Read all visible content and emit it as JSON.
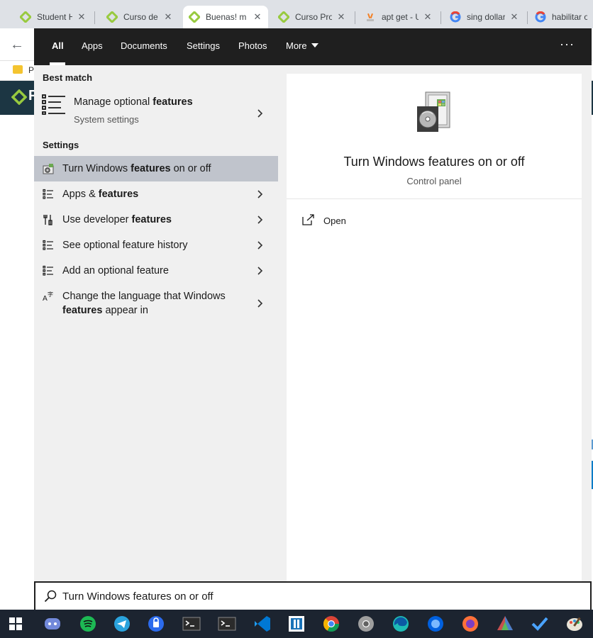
{
  "browser": {
    "tabs": [
      {
        "label": "Student He",
        "icon": "platzi-icon"
      },
      {
        "label": "Curso de P",
        "icon": "platzi-icon"
      },
      {
        "label": "Buenas! m",
        "icon": "platzi-icon"
      },
      {
        "label": "Curso Prof",
        "icon": "platzi-icon"
      },
      {
        "label": "apt get - U",
        "icon": "stackoverflow-icon"
      },
      {
        "label": "sing dollar",
        "icon": "google-icon"
      },
      {
        "label": "habilitar o",
        "icon": "google-icon"
      }
    ],
    "close_glyph": "✕",
    "bookmark_label": "P",
    "site_logo_text": "P"
  },
  "start": {
    "filters": {
      "all": "All",
      "apps": "Apps",
      "documents": "Documents",
      "settings": "Settings",
      "photos": "Photos",
      "more": "More"
    },
    "overflow": "···",
    "best_match": {
      "heading": "Best match",
      "title_prefix": "Manage optional ",
      "title_bold": "features",
      "subtitle": "System settings"
    },
    "settings": {
      "heading": "Settings",
      "items": [
        {
          "prefix": "Turn Windows ",
          "bold": "features",
          "suffix": " on or off",
          "icon": "control-panel-icon"
        },
        {
          "prefix": "Apps & ",
          "bold": "features",
          "suffix": "",
          "icon": "apps-list-icon"
        },
        {
          "prefix": "Use developer ",
          "bold": "features",
          "suffix": "",
          "icon": "developer-tools-icon"
        },
        {
          "prefix": "See optional feature history",
          "bold": "",
          "suffix": "",
          "icon": "history-list-icon"
        },
        {
          "prefix": "Add an optional feature",
          "bold": "",
          "suffix": "",
          "icon": "add-list-icon"
        },
        {
          "prefix": "Change the language that Windows",
          "bold": "features",
          "suffix": " appear in",
          "icon": "language-icon"
        }
      ]
    },
    "preview": {
      "title": "Turn Windows features on or off",
      "subtitle": "Control panel",
      "action_open": "Open"
    },
    "search": {
      "value": "Turn Windows features on or off",
      "placeholder": ""
    }
  },
  "taskbar": {
    "items": [
      "windows-start-icon",
      "discord-icon",
      "spotify-icon",
      "telegram-icon",
      "signal-icon",
      "terminal-icon",
      "terminal-icon",
      "vscode-icon",
      "hyperv-icon",
      "chrome-icon",
      "chrome-dev-icon",
      "edge-icon",
      "firefox-dev-icon",
      "firefox-icon",
      "prism-icon",
      "todo-icon",
      "paint-icon"
    ]
  },
  "watermark": "Platzi",
  "colors": {
    "menu_dark": "#1f1f1f",
    "pane_light": "#f0f0f0",
    "selected_row": "#c0c4cc",
    "platzi_green": "#98ca3f",
    "taskbar": "#1c2430"
  }
}
